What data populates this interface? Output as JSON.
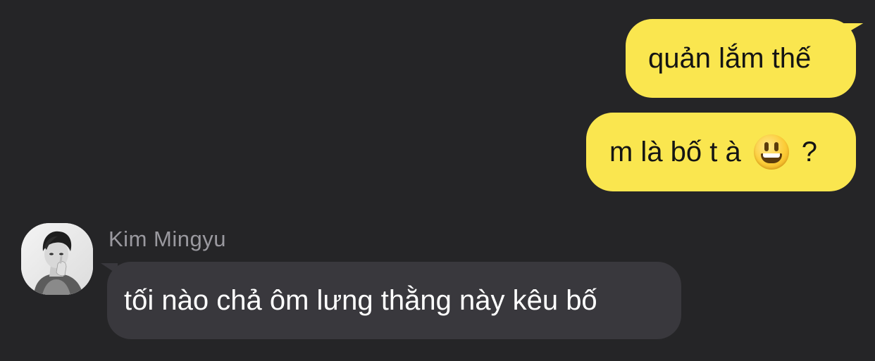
{
  "messages": [
    {
      "direction": "sent",
      "text": "quản lắm thế"
    },
    {
      "direction": "sent",
      "text_before": "m là bố t à",
      "emoji": "grinning-face-big-eyes-icon",
      "text_after": "?"
    },
    {
      "direction": "received",
      "sender": "Kim Mingyu",
      "text": "tối nào chả ôm lưng thằng này kêu bố"
    }
  ],
  "colors": {
    "background": "#252527",
    "sent_bubble": "#fae64f",
    "received_bubble": "#39383d",
    "sender_name": "#9a999f"
  }
}
